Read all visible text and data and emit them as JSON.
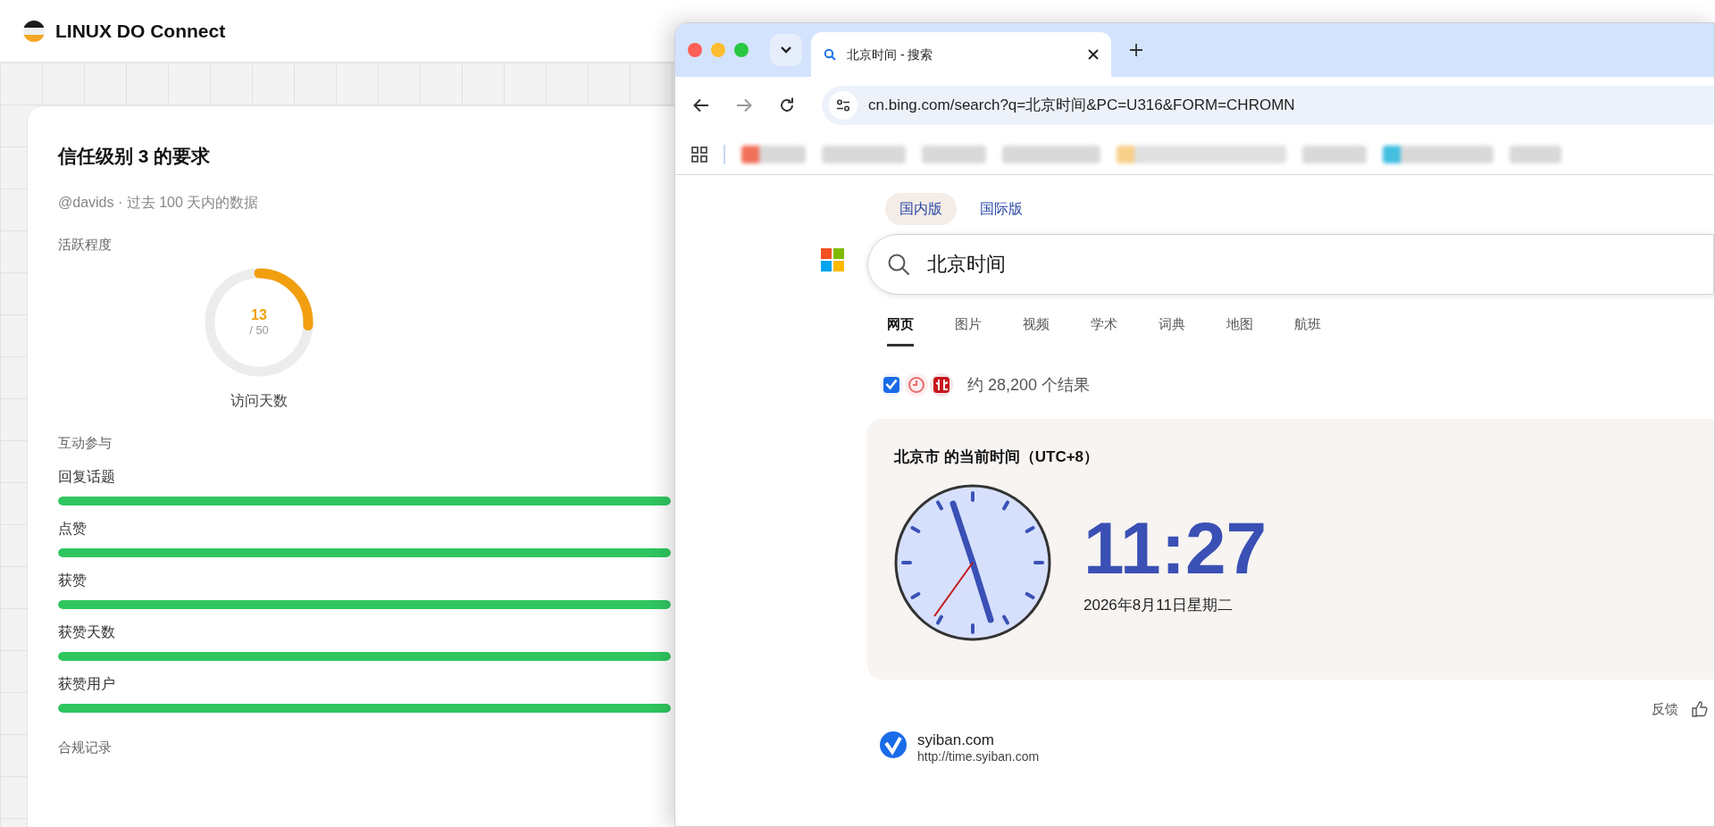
{
  "app": {
    "title": "LINUX DO Connect"
  },
  "card": {
    "title": "信任级别 3 的要求",
    "subtitle": "@davids · 过去 100 天内的数据",
    "activity": {
      "heading": "活跃程度",
      "gauge": {
        "value": "13",
        "total": "/ 50",
        "label": "访问天数",
        "level": 0.26
      }
    },
    "engagement": {
      "heading": "互动参与",
      "items": [
        {
          "label": "回复话题",
          "level": 1
        },
        {
          "label": "点赞",
          "level": 1
        },
        {
          "label": "获赞",
          "level": 1
        },
        {
          "label": "获赞天数",
          "level": 1
        },
        {
          "label": "获赞用户",
          "level": 1
        }
      ]
    },
    "compliance": {
      "heading": "合规记录"
    }
  },
  "browser": {
    "tab": {
      "title": "北京时间 - 搜索"
    },
    "address": "cn.bing.com/search?q=北京时间&PC=U316&FORM=CHROMN",
    "page": {
      "market_tabs": [
        {
          "label": "国内版",
          "selected": true
        },
        {
          "label": "国际版",
          "selected": false
        }
      ],
      "search": {
        "value": "北京时间"
      },
      "verticals": [
        {
          "label": "网页",
          "selected": true
        },
        {
          "label": "图片",
          "selected": false
        },
        {
          "label": "视频",
          "selected": false
        },
        {
          "label": "学术",
          "selected": false
        },
        {
          "label": "词典",
          "selected": false
        },
        {
          "label": "地图",
          "selected": false
        },
        {
          "label": "航班",
          "selected": false
        }
      ],
      "result_count": "约 28,200 个结果",
      "time_card": {
        "title": "北京市 的当前时间（UTC+8）",
        "time": "11:27",
        "date": "2026年8月11日星期二"
      },
      "feedback": "反馈",
      "results": [
        {
          "site": "syiban.com",
          "url": "http://time.syiban.com"
        }
      ]
    }
  }
}
